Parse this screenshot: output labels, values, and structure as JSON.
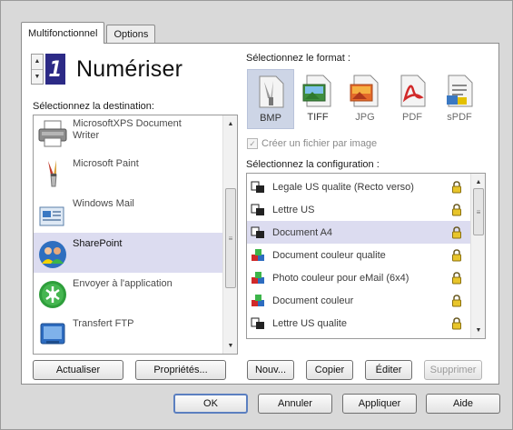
{
  "tabs": [
    {
      "label": "Multifonctionnel",
      "active": true
    },
    {
      "label": "Options",
      "active": false
    }
  ],
  "scan": {
    "digit": "1",
    "title": "Numériser"
  },
  "destination": {
    "label": "Sélectionnez la destination:",
    "items": [
      {
        "label": "MicrosoftXPS Document Writer",
        "icon": "printer-icon",
        "selected": false
      },
      {
        "label": "Microsoft Paint",
        "icon": "paint-icon",
        "selected": false
      },
      {
        "label": "Windows Mail",
        "icon": "windows-mail-icon",
        "selected": false
      },
      {
        "label": "SharePoint",
        "icon": "sharepoint-icon",
        "selected": true
      },
      {
        "label": "Envoyer à l'application",
        "icon": "send-to-app-icon",
        "selected": false
      },
      {
        "label": "Transfert FTP",
        "icon": "ftp-transfer-icon",
        "selected": false
      }
    ]
  },
  "format": {
    "label": "Sélectionnez le format :",
    "items": [
      {
        "label": "BMP",
        "icon": "bmp-icon",
        "selected": true,
        "enabled": true
      },
      {
        "label": "TIFF",
        "icon": "tiff-icon",
        "selected": false,
        "enabled": true
      },
      {
        "label": "JPG",
        "icon": "jpg-icon",
        "selected": false,
        "enabled": false
      },
      {
        "label": "PDF",
        "icon": "pdf-icon",
        "selected": false,
        "enabled": false
      },
      {
        "label": "sPDF",
        "icon": "spdf-icon",
        "selected": false,
        "enabled": false
      }
    ]
  },
  "checkbox": {
    "label": "Créer un fichier par image",
    "checked": true,
    "enabled": false
  },
  "configuration": {
    "label": "Sélectionnez la configuration :",
    "items": [
      {
        "label": "Legale US qualite (Recto verso)",
        "icon": "bw-document-icon",
        "selected": false
      },
      {
        "label": "Lettre US",
        "icon": "bw-document-icon",
        "selected": false
      },
      {
        "label": "Document A4",
        "icon": "bw-document-icon",
        "selected": true
      },
      {
        "label": "Document couleur qualite",
        "icon": "color-document-icon",
        "selected": false
      },
      {
        "label": "Photo couleur pour eMail (6x4)",
        "icon": "color-document-icon",
        "selected": false
      },
      {
        "label": "Document couleur",
        "icon": "color-document-icon",
        "selected": false
      },
      {
        "label": "Lettre US qualite",
        "icon": "bw-document-icon",
        "selected": false
      }
    ]
  },
  "buttons": {
    "refresh": "Actualiser",
    "properties": "Propriétés...",
    "new": "Nouv...",
    "copy": "Copier",
    "edit": "Éditer",
    "delete": "Supprimer",
    "ok": "OK",
    "cancel": "Annuler",
    "apply": "Appliquer",
    "help": "Aide"
  },
  "colors": {
    "selection": "#dcdcf0",
    "digit_background": "#2c2a86",
    "format_selected": "#cdd5e6"
  }
}
